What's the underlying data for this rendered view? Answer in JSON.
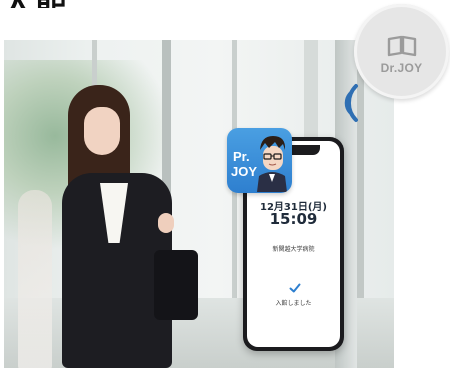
{
  "heading": {
    "cropped_text": "入館"
  },
  "badge": {
    "brand_label": "Dr.JOY",
    "icon": "book-icon"
  },
  "app_icon": {
    "line1": "Pr.",
    "line2": "JOY",
    "icon": "character-avatar"
  },
  "phone": {
    "date": "12月31日(月)",
    "time": "15:09",
    "place": "新関越大学病院",
    "status": "入館しました",
    "status_icon": "check-icon"
  },
  "reader": {
    "icon": "nfc-waves-icon"
  },
  "colors": {
    "accent_blue": "#2e7fcf",
    "text_dark": "#1f2b3a",
    "badge_gray": "#e6e6e6"
  }
}
